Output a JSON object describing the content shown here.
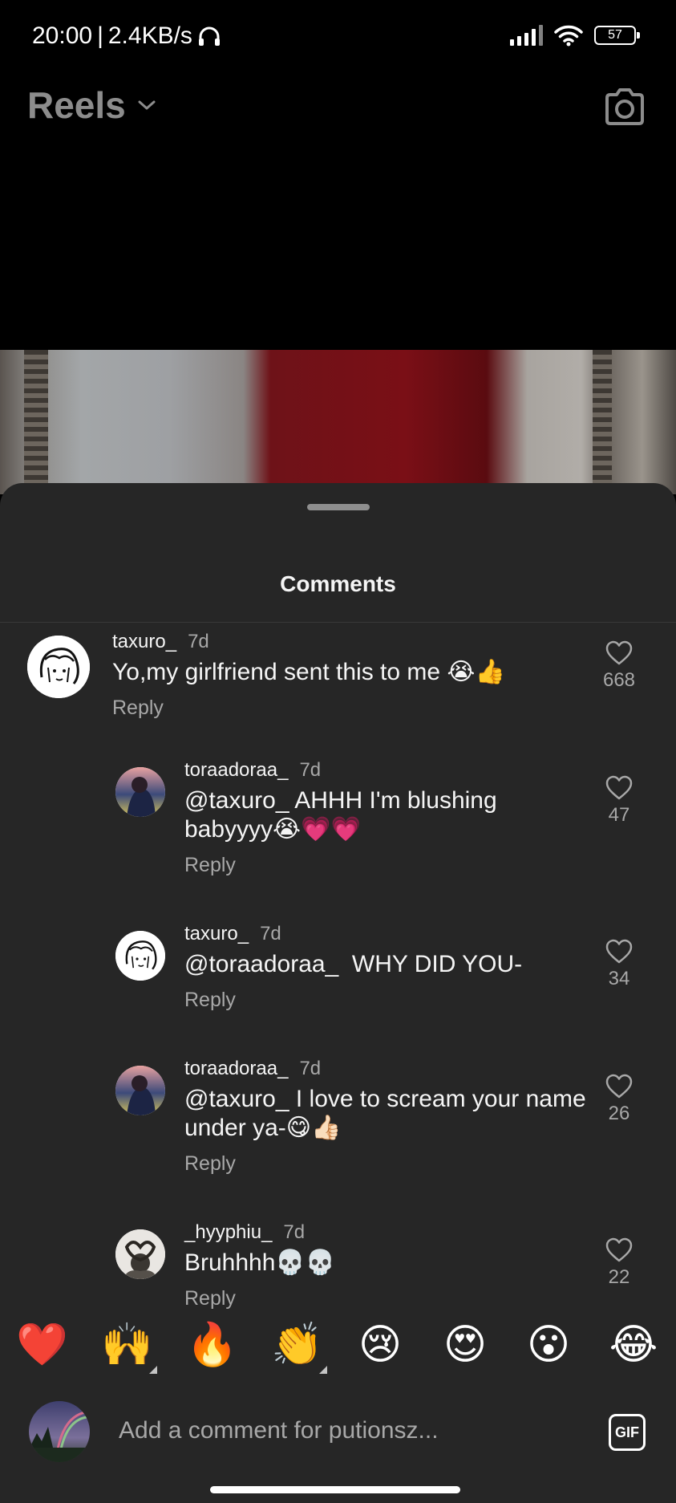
{
  "status_bar": {
    "time": "20:00",
    "network_speed": "2.4KB/s",
    "battery_level": "57",
    "icons": [
      "headphones-icon",
      "signal-icon",
      "wifi-icon",
      "battery-icon"
    ]
  },
  "header": {
    "title": "Reels",
    "dropdown_icon": "chevron-down-icon",
    "camera_icon": "camera-icon"
  },
  "sheet": {
    "title": "Comments"
  },
  "comments": [
    {
      "username": "taxuro_",
      "time": "7d",
      "text": "Yo,my girlfriend sent this to me 😭👍",
      "reply_label": "Reply",
      "likes": "668",
      "avatar": "sketch-avatar",
      "is_reply": false
    },
    {
      "username": "toraadoraa_",
      "time": "7d",
      "text": "@taxuro_ AHHH I'm blushing babyyyy😭💗💗",
      "reply_label": "Reply",
      "likes": "47",
      "avatar": "photo-avatar",
      "is_reply": true
    },
    {
      "username": "taxuro_",
      "time": "7d",
      "text": "@toraadoraa_  WHY DID YOU-",
      "reply_label": "Reply",
      "likes": "34",
      "avatar": "sketch-avatar",
      "is_reply": true
    },
    {
      "username": "toraadoraa_",
      "time": "7d",
      "text": "@taxuro_ I love to scream your name under ya-😋👍🏻",
      "reply_label": "Reply",
      "likes": "26",
      "avatar": "photo-avatar",
      "is_reply": true
    },
    {
      "username": "_hyyphiu_",
      "time": "7d",
      "text": "Bruhhhh💀💀",
      "reply_label": "Reply",
      "likes": "22",
      "avatar": "heart-hands-avatar",
      "is_reply": true
    }
  ],
  "emoji_bar": [
    "❤️",
    "🙌",
    "🔥",
    "👏",
    "😢",
    "😍",
    "😮",
    "😂"
  ],
  "composer": {
    "placeholder": "Add a comment for putionsz...",
    "gif_label": "GIF"
  },
  "colors": {
    "background": "#000000",
    "sheet": "#262626",
    "primary_text": "#f5f5f5",
    "secondary_text": "#a8a8a8"
  }
}
